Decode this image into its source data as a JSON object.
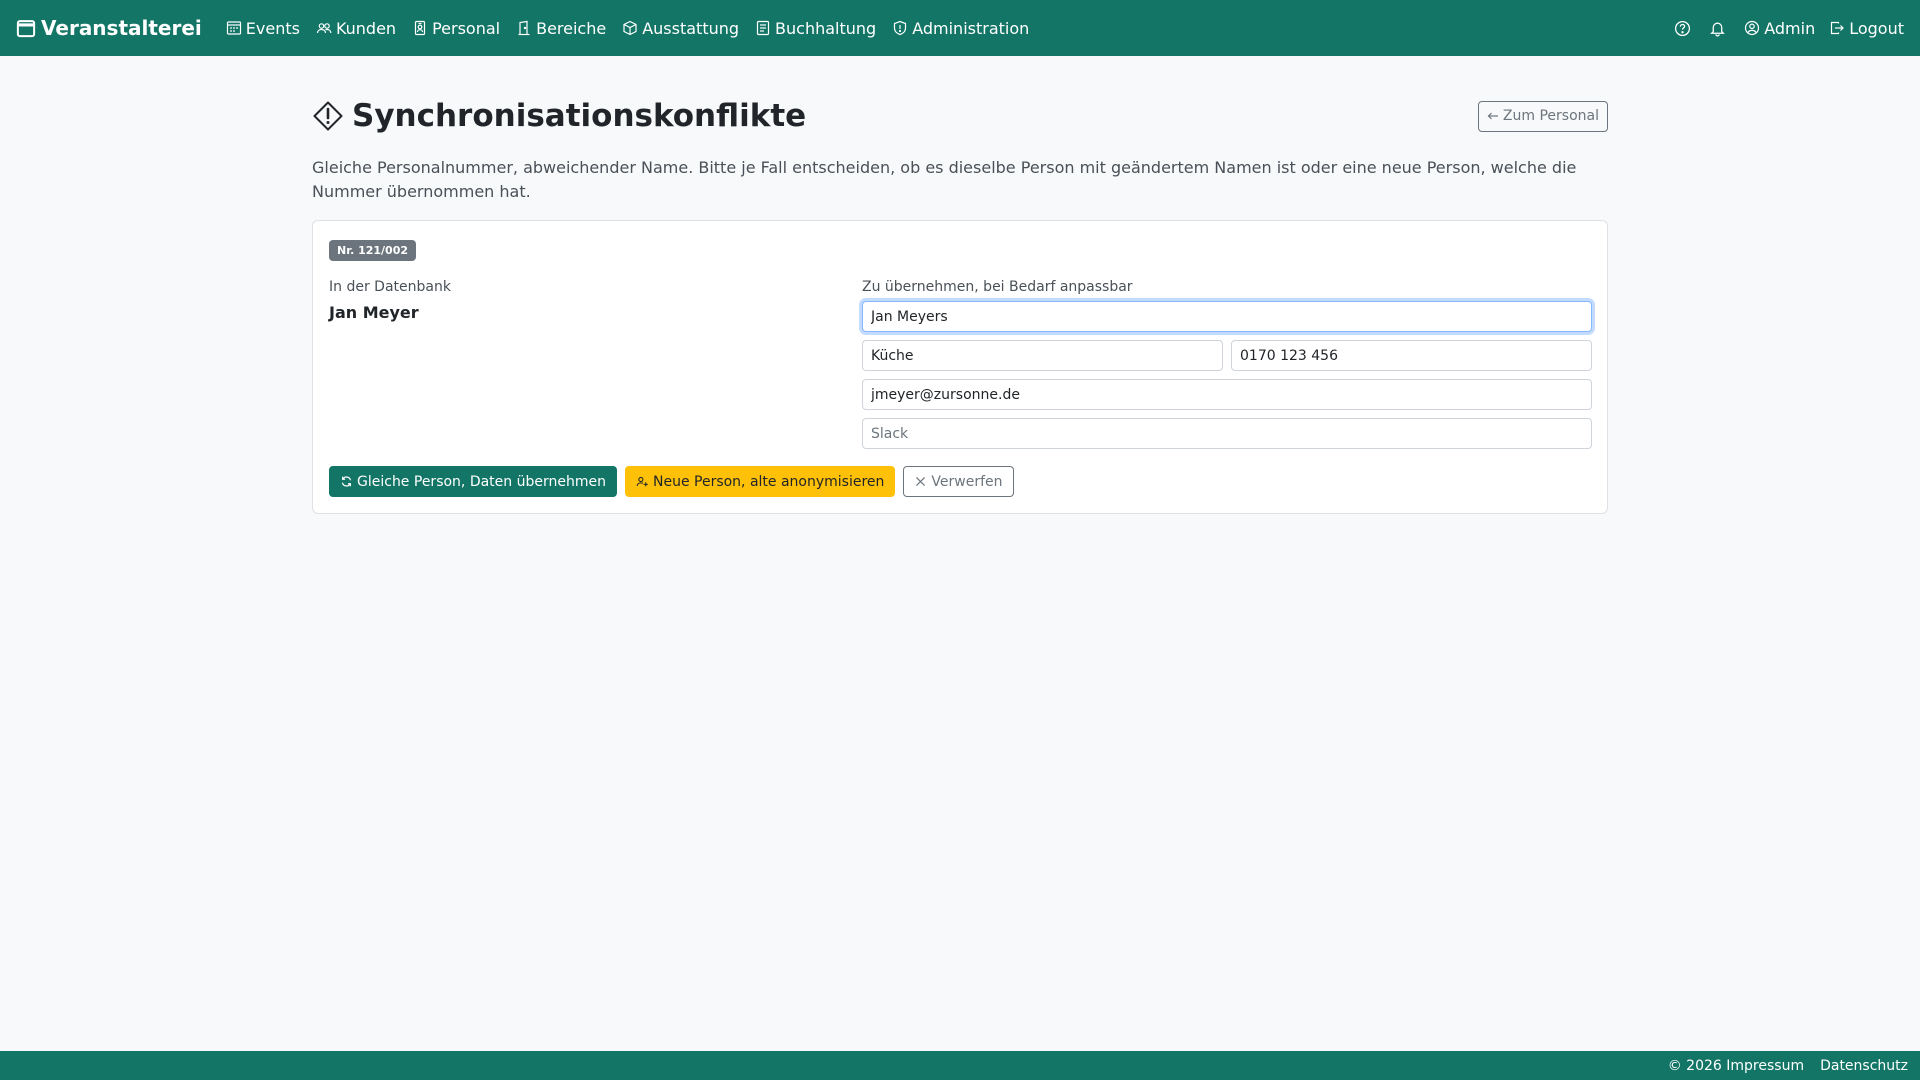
{
  "navbar": {
    "brand": "Veranstalterei",
    "items": [
      {
        "label": "Events",
        "icon": "calendar-grid-icon"
      },
      {
        "label": "Kunden",
        "icon": "people-icon"
      },
      {
        "label": "Personal",
        "icon": "badge-icon"
      },
      {
        "label": "Bereiche",
        "icon": "door-icon"
      },
      {
        "label": "Ausstattung",
        "icon": "box-icon"
      },
      {
        "label": "Buchhaltung",
        "icon": "ledger-icon"
      },
      {
        "label": "Administration",
        "icon": "shield-icon"
      }
    ],
    "admin_label": "Admin",
    "logout_label": "Logout"
  },
  "page": {
    "title": "Synchronisationskonflikte",
    "back_button": "Zum Personal",
    "description": "Gleiche Personalnummer, abweichender Name. Bitte je Fall entscheiden, ob es dieselbe Person mit geändertem Namen ist oder eine neue Person, welche die Nummer übernommen hat."
  },
  "conflict": {
    "badge": "Nr. 121/002",
    "db_label": "In der Datenbank",
    "db_name": "Jan Meyer",
    "new_label": "Zu übernehmen, bei Bedarf anpassbar",
    "fields": {
      "name": "Jan Meyers",
      "department": "Küche",
      "phone": "0170 123 456",
      "email": "jmeyer@zursonne.de",
      "slack_placeholder": "Slack"
    },
    "actions": {
      "same_person": "Gleiche Person, Daten übernehmen",
      "new_person": "Neue Person, alte anonymisieren",
      "discard": "Verwerfen"
    }
  },
  "footer": {
    "impressum": "© 2026 Impressum",
    "datenschutz": "Datenschutz"
  },
  "colors": {
    "primary": "#127566",
    "warning": "#ffc107",
    "secondary": "#6c757d"
  }
}
